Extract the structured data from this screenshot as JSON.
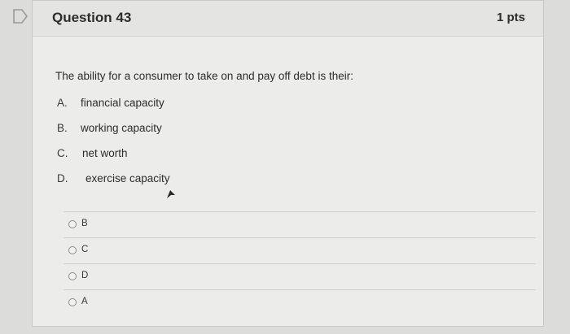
{
  "flag_icon": "flag-icon",
  "question": {
    "title": "Question 43",
    "points": "1 pts",
    "text": "The ability for a consumer to take on and  pay off debt is their:",
    "choices": [
      {
        "letter": "A.",
        "text": "financial capacity"
      },
      {
        "letter": "B.",
        "text": "working capacity"
      },
      {
        "letter": "C.",
        "text": "net worth"
      },
      {
        "letter": "D.",
        "text": "exercise capacity"
      }
    ]
  },
  "answers": [
    {
      "label": "B"
    },
    {
      "label": "C"
    },
    {
      "label": "D"
    },
    {
      "label": "A"
    }
  ]
}
